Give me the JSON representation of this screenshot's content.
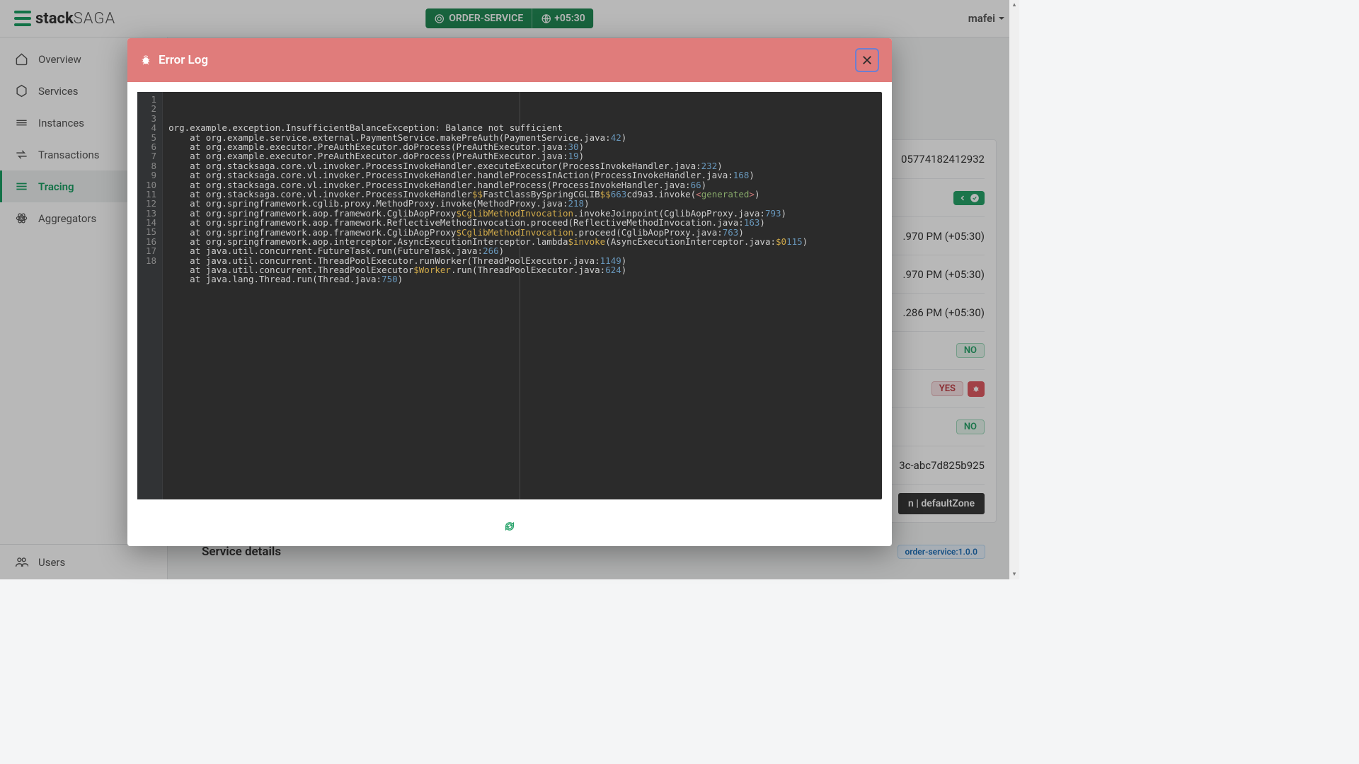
{
  "header": {
    "brand_bold": "stack",
    "brand_light": "SAGA",
    "service_badge": "ORDER-SERVICE",
    "timezone": "+05:30",
    "user": "mafei"
  },
  "sidebar": {
    "items": [
      {
        "label": "Overview"
      },
      {
        "label": "Services"
      },
      {
        "label": "Instances"
      },
      {
        "label": "Transactions"
      },
      {
        "label": "Tracing"
      },
      {
        "label": "Aggregators"
      }
    ],
    "bottom": {
      "label": "Users"
    }
  },
  "backdrop": {
    "frag_id": "05774182412932",
    "time1": ".970 PM (+05:30)",
    "time2": ".970 PM (+05:30)",
    "time3": ".286 PM (+05:30)",
    "no1": "NO",
    "yes": "YES",
    "no2": "NO",
    "frag_hash": "3c-abc7d825b925",
    "zone": "n | defaultZone",
    "svc_details": "Service details",
    "svc_version": "order-service:1.0.0"
  },
  "modal": {
    "title": "Error Log",
    "total_lines": 18
  },
  "stack": [
    {
      "pre": "org.example.exception.InsufficientBalanceException: Balance not sufficient"
    },
    {
      "pre": "    at org.example.service.external.PaymentService.makePreAuth(PaymentService.java:",
      "num": "42",
      "post": ")"
    },
    {
      "pre": "    at org.example.executor.PreAuthExecutor.doProcess(PreAuthExecutor.java:",
      "num": "30",
      "post": ")"
    },
    {
      "pre": "    at org.example.executor.PreAuthExecutor.doProcess(PreAuthExecutor.java:",
      "num": "19",
      "post": ")"
    },
    {
      "pre": "    at org.stacksaga.core.vl.invoker.ProcessInvokeHandler.executeExecutor(ProcessInvokeHandler.java:",
      "num": "232",
      "post": ")"
    },
    {
      "pre": "    at org.stacksaga.core.vl.invoker.ProcessInvokeHandler.handleProcessInAction(ProcessInvokeHandler.java:",
      "num": "168",
      "post": ")"
    },
    {
      "pre": "    at org.stacksaga.core.vl.invoker.ProcessInvokeHandler.handleProcess(ProcessInvokeHandler.java:",
      "num": "66",
      "post": ")"
    },
    {
      "pre": "    at org.stacksaga.core.vl.invoker.ProcessInvokeHandler",
      "y": "$$",
      "post1": "FastClassBySpringCGLIB",
      "y2": "$$",
      "num": "663",
      "post2": "cd9a3.invoke(",
      "g": "<generated>",
      "post3": ")"
    },
    {
      "pre": "    at org.springframework.cglib.proxy.MethodProxy.invoke(MethodProxy.java:",
      "num": "218",
      "post": ")"
    },
    {
      "pre": "    at org.springframework.aop.framework.CglibAopProxy",
      "y": "$CglibMethodInvocation",
      "post1": ".invokeJoinpoint(CglibAopProxy.java:",
      "num": "793",
      "post": ")"
    },
    {
      "pre": "    at org.springframework.aop.framework.ReflectiveMethodInvocation.proceed(ReflectiveMethodInvocation.java:",
      "num": "163",
      "post": ")"
    },
    {
      "pre": "    at org.springframework.aop.framework.CglibAopProxy",
      "y": "$CglibMethodInvocation",
      "post1": ".proceed(CglibAopProxy.java:",
      "num": "763",
      "post": ")"
    },
    {
      "pre": "    at org.springframework.aop.interceptor.AsyncExecutionInterceptor.lambda",
      "y": "$invoke",
      "y2": "$0",
      "post1": "(AsyncExecutionInterceptor.java:",
      "num": "115",
      "post": ")"
    },
    {
      "pre": "    at java.util.concurrent.FutureTask.run(FutureTask.java:",
      "num": "266",
      "post": ")"
    },
    {
      "pre": "    at java.util.concurrent.ThreadPoolExecutor.runWorker(ThreadPoolExecutor.java:",
      "num": "1149",
      "post": ")"
    },
    {
      "pre": "    at java.util.concurrent.ThreadPoolExecutor",
      "y": "$Worker",
      "post1": ".run(ThreadPoolExecutor.java:",
      "num": "624",
      "post": ")"
    },
    {
      "pre": "    at java.lang.Thread.run(Thread.java:",
      "num": "750",
      "post": ")"
    }
  ]
}
